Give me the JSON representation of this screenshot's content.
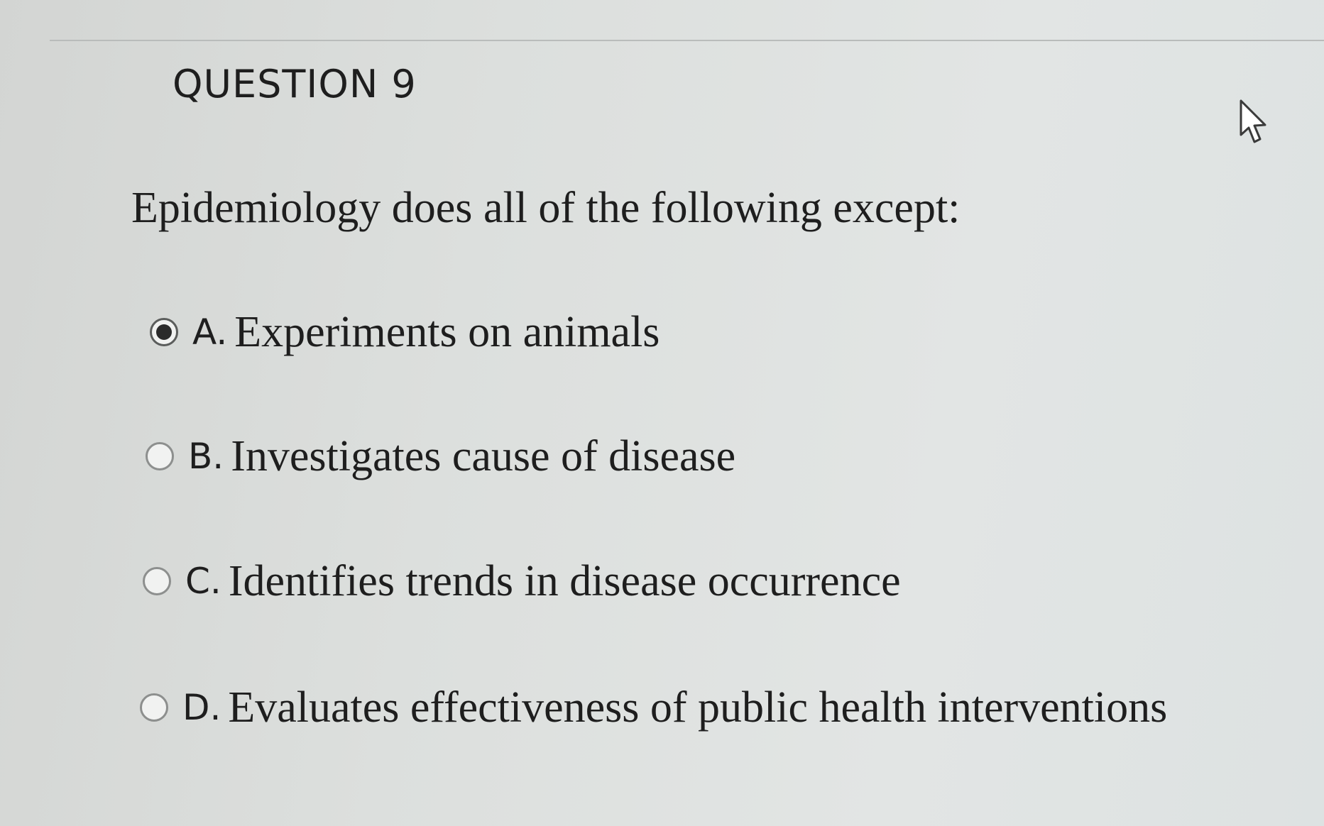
{
  "question": {
    "number_label": "QUESTION 9",
    "text": "Epidemiology does all of the following except:"
  },
  "options": [
    {
      "letter": "A.",
      "text": "Experiments on animals",
      "selected": true
    },
    {
      "letter": "B.",
      "text": "Investigates cause of disease",
      "selected": false
    },
    {
      "letter": "C.",
      "text": "Identifies trends in disease occurrence",
      "selected": false
    },
    {
      "letter": "D.",
      "text": "Evaluates effectiveness of public health interventions",
      "selected": false
    }
  ],
  "cursor": {
    "icon": "mouse-pointer-icon"
  },
  "colors": {
    "background": "#dcdfdd",
    "text": "#1e1e1e",
    "radio_border": "#8d8f8e",
    "radio_selected_dot": "#2b2b2b"
  }
}
